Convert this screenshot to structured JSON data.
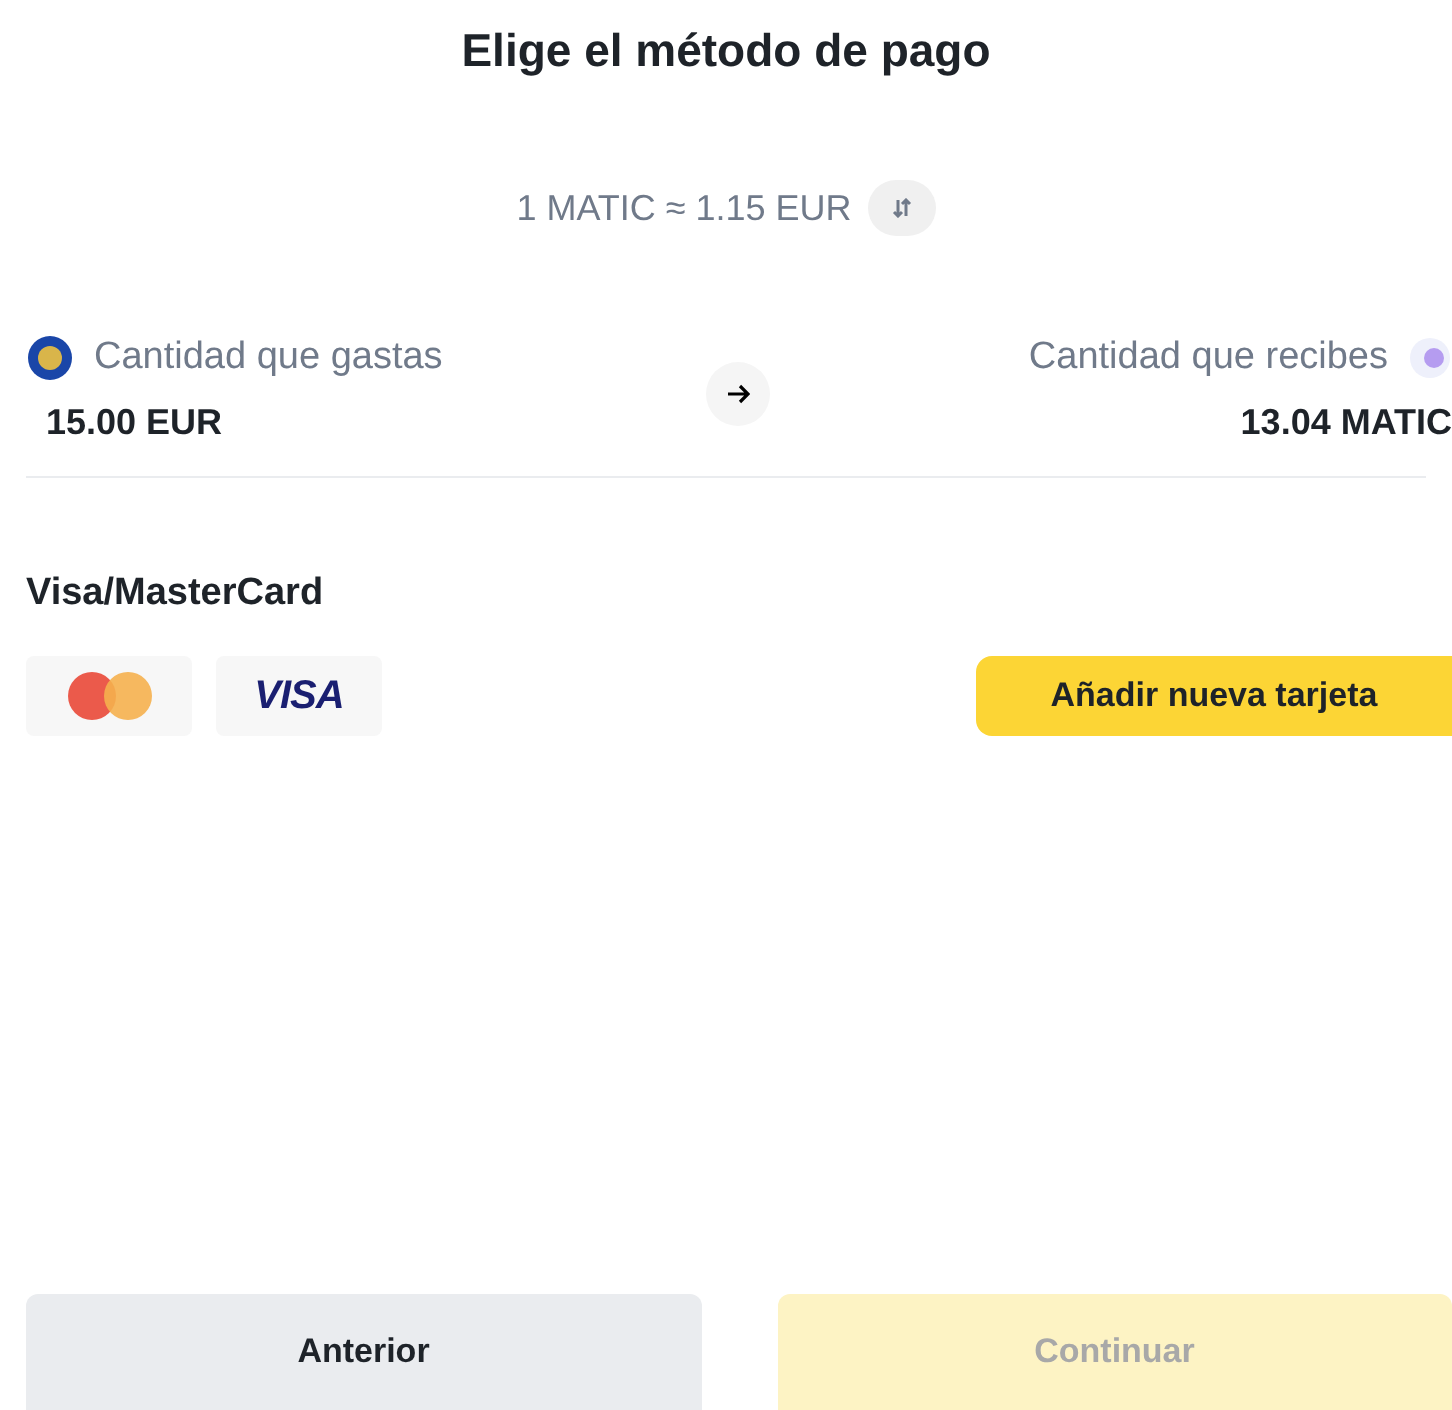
{
  "title": "Elige el método de pago",
  "rate": "1 MATIC ≈ 1.15 EUR",
  "spend": {
    "label": "Cantidad que gastas",
    "amount": "15.00 EUR"
  },
  "receive": {
    "label": "Cantidad que recibes",
    "amount": "13.04 MATIC"
  },
  "method": {
    "title": "Visa/MasterCard",
    "cards": [
      {
        "kind": "mastercard"
      },
      {
        "kind": "visa",
        "label": "VISA"
      }
    ],
    "add_button": "Añadir nueva tarjeta"
  },
  "buttons": [
    {
      "label": "Anterior",
      "kind": "secondary",
      "disabled": false
    },
    {
      "label": "Continuar",
      "kind": "primary",
      "disabled": true
    }
  ]
}
